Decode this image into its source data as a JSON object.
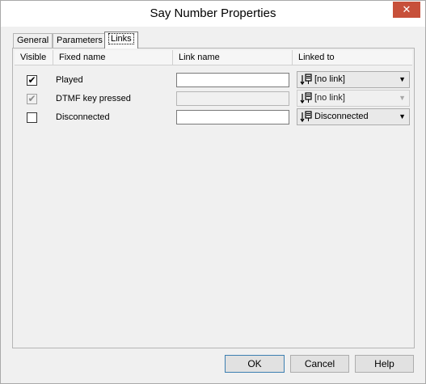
{
  "window": {
    "title": "Say Number Properties",
    "close_glyph": "✕"
  },
  "tabs": [
    {
      "label": "General"
    },
    {
      "label": "Parameters"
    },
    {
      "label": "Links"
    }
  ],
  "columns": {
    "visible": "Visible",
    "fixed_name": "Fixed name",
    "link_name": "Link name",
    "linked_to": "Linked to"
  },
  "rows": [
    {
      "checked": true,
      "check_glyph": "✔",
      "fixed_name": "Played",
      "link_name": "",
      "linked_to": "[no link]",
      "enabled": true
    },
    {
      "checked": true,
      "check_glyph": "✔",
      "fixed_name": "DTMF key pressed",
      "link_name": "",
      "linked_to": "[no link]",
      "enabled": false
    },
    {
      "checked": false,
      "check_glyph": "",
      "fixed_name": "Disconnected",
      "link_name": "",
      "linked_to": "Disconnected",
      "enabled": true
    }
  ],
  "icons": {
    "link": "link-target-icon",
    "dropdown": "chevron-down-icon",
    "dropdown_glyph": "▼"
  },
  "buttons": {
    "ok": "OK",
    "cancel": "Cancel",
    "help": "Help"
  },
  "colors": {
    "close_button": "#c7503a",
    "default_button_border": "#3c7fb1"
  }
}
